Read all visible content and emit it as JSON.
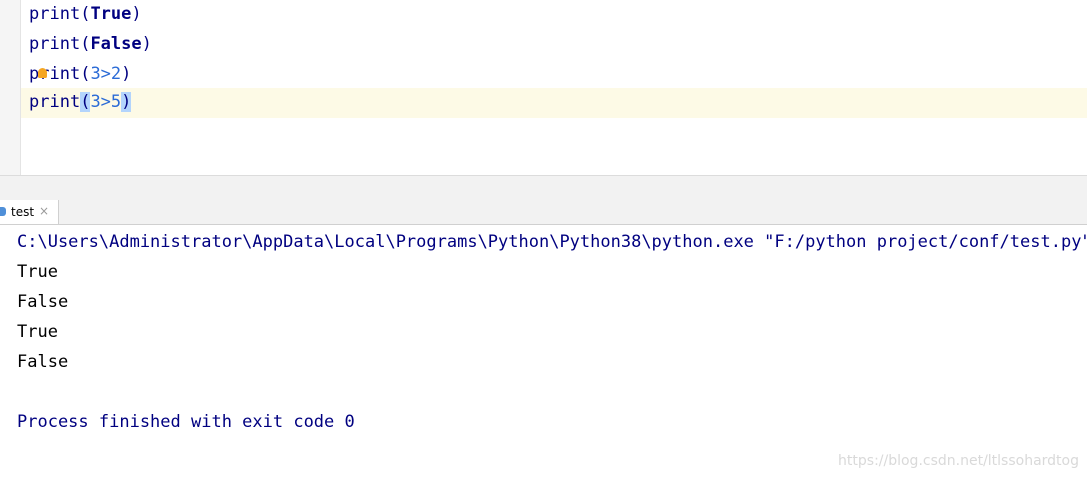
{
  "editor": {
    "lines": [
      {
        "fn": "print",
        "open": "(",
        "arg": "True",
        "close": ")"
      },
      {
        "fn": "print",
        "open": "(",
        "arg": "False",
        "close": ")"
      },
      {
        "fn": "print",
        "open": "(",
        "arg": "3>2",
        "close": ")"
      },
      {
        "fn": "print",
        "open": "(",
        "arg": "3>5",
        "close": ")"
      }
    ]
  },
  "run_tab": {
    "label": "test",
    "close": "×"
  },
  "console": {
    "command": "C:\\Users\\Administrator\\AppData\\Local\\Programs\\Python\\Python38\\python.exe \"F:/python project/conf/test.py\"",
    "outputs": [
      "True",
      "False",
      "True",
      "False"
    ],
    "exit_message": "Process finished with exit code 0"
  },
  "watermark": "https://blog.csdn.net/ltlssohardtog",
  "colors": {
    "code_text": "#000080",
    "current_line": "#fdfae6",
    "selection": "#b3d4fc",
    "bulb": "#f5a623",
    "watermark": "#d9d9d9"
  },
  "icons": [
    "intention-bulb-icon",
    "run-config-icon",
    "close-tab-icon"
  ]
}
